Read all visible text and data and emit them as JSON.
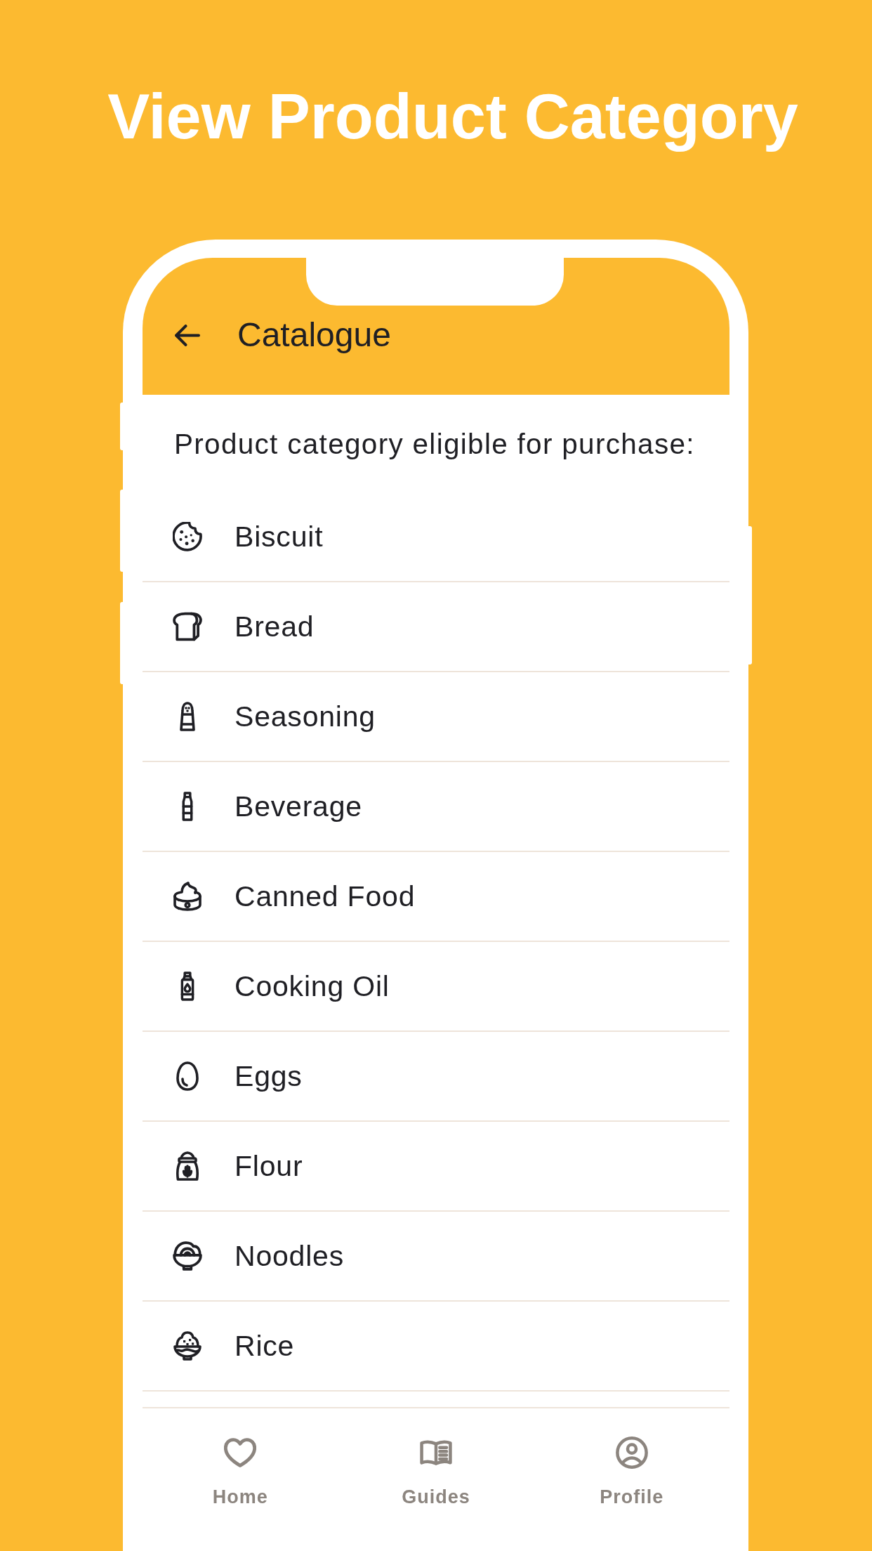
{
  "heading": "View Product Category",
  "app_bar": {
    "title": "Catalogue"
  },
  "intro": "Product category eligible for purchase:",
  "categories": [
    {
      "label": "Biscuit",
      "kind": "cookie"
    },
    {
      "label": "Bread",
      "kind": "bread"
    },
    {
      "label": "Seasoning",
      "kind": "shaker"
    },
    {
      "label": "Beverage",
      "kind": "bottle"
    },
    {
      "label": "Canned Food",
      "kind": "can"
    },
    {
      "label": "Cooking Oil",
      "kind": "oil"
    },
    {
      "label": "Eggs",
      "kind": "egg"
    },
    {
      "label": "Flour",
      "kind": "sack"
    },
    {
      "label": "Noodles",
      "kind": "noodles"
    },
    {
      "label": "Rice",
      "kind": "rice"
    }
  ],
  "bottom_nav": [
    {
      "label": "Home",
      "kind": "heart"
    },
    {
      "label": "Guides",
      "kind": "book"
    },
    {
      "label": "Profile",
      "kind": "user"
    }
  ]
}
